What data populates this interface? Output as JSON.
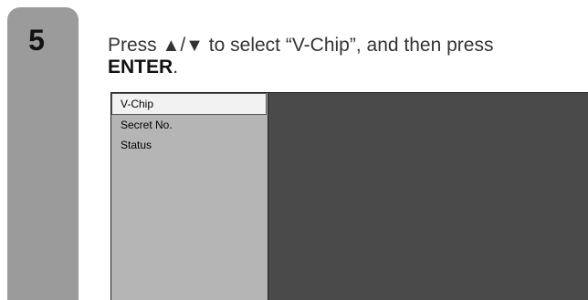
{
  "step": {
    "number": "5"
  },
  "instruction": {
    "press": "Press ",
    "arrow_up": "▲",
    "slash": "/",
    "arrow_down": "▼",
    "middle": " to select “V-Chip”, and then press",
    "enter": "ENTER",
    "period": "."
  },
  "menu": {
    "items": [
      {
        "label": "V-Chip",
        "selected": true
      },
      {
        "label": "Secret No.",
        "selected": false
      },
      {
        "label": "Status",
        "selected": false
      }
    ]
  },
  "colors": {
    "step_bar": "#9b9b9b",
    "menu_bg": "#b5b5b5",
    "selected_bg": "#f2f2f2",
    "preview_bg": "#4a4a4a"
  }
}
